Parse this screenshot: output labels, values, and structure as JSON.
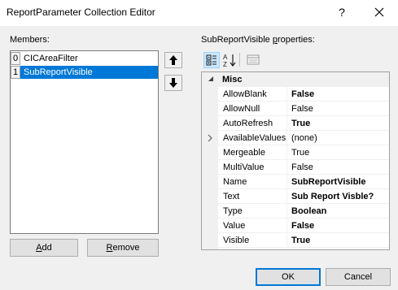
{
  "window": {
    "title": "ReportParameter Collection Editor",
    "help_glyph": "?"
  },
  "members": {
    "label": "Members:",
    "items": [
      {
        "index": "0",
        "name": "CICAreaFilter",
        "selected": false
      },
      {
        "index": "1",
        "name": "SubReportVisible",
        "selected": true
      }
    ],
    "add_label_pre": "",
    "add_label_u": "A",
    "add_label_post": "dd",
    "remove_label_pre": "",
    "remove_label_u": "R",
    "remove_label_post": "emove"
  },
  "properties": {
    "label_pre": "SubReportVisible ",
    "label_u": "p",
    "label_post": "roperties:",
    "category": "Misc",
    "rows": [
      {
        "name": "AllowBlank",
        "value": "False",
        "bold": true
      },
      {
        "name": "AllowNull",
        "value": "False",
        "bold": false
      },
      {
        "name": "AutoRefresh",
        "value": "True",
        "bold": true
      },
      {
        "name": "AvailableValues",
        "value": "(none)",
        "bold": false,
        "expandable": true
      },
      {
        "name": "Mergeable",
        "value": "True",
        "bold": false
      },
      {
        "name": "MultiValue",
        "value": "False",
        "bold": false
      },
      {
        "name": "Name",
        "value": "SubReportVisible",
        "bold": true
      },
      {
        "name": "Text",
        "value": "Sub Report Visble?",
        "bold": true
      },
      {
        "name": "Type",
        "value": "Boolean",
        "bold": true
      },
      {
        "name": "Value",
        "value": "False",
        "bold": true
      },
      {
        "name": "Visible",
        "value": "True",
        "bold": true
      }
    ]
  },
  "footer": {
    "ok_label": "OK",
    "cancel_label": "Cancel"
  },
  "icons": {
    "close": "close-icon",
    "move_up": "arrow-up-icon",
    "move_down": "arrow-down-icon",
    "categorized": "categorized-icon",
    "alphabetical": "alphabetical-sort-icon",
    "property_pages": "property-pages-icon"
  },
  "colors": {
    "selection": "#0078d7",
    "window_bg": "#f0f0f0",
    "toolbar_active": "#cce8ff"
  }
}
